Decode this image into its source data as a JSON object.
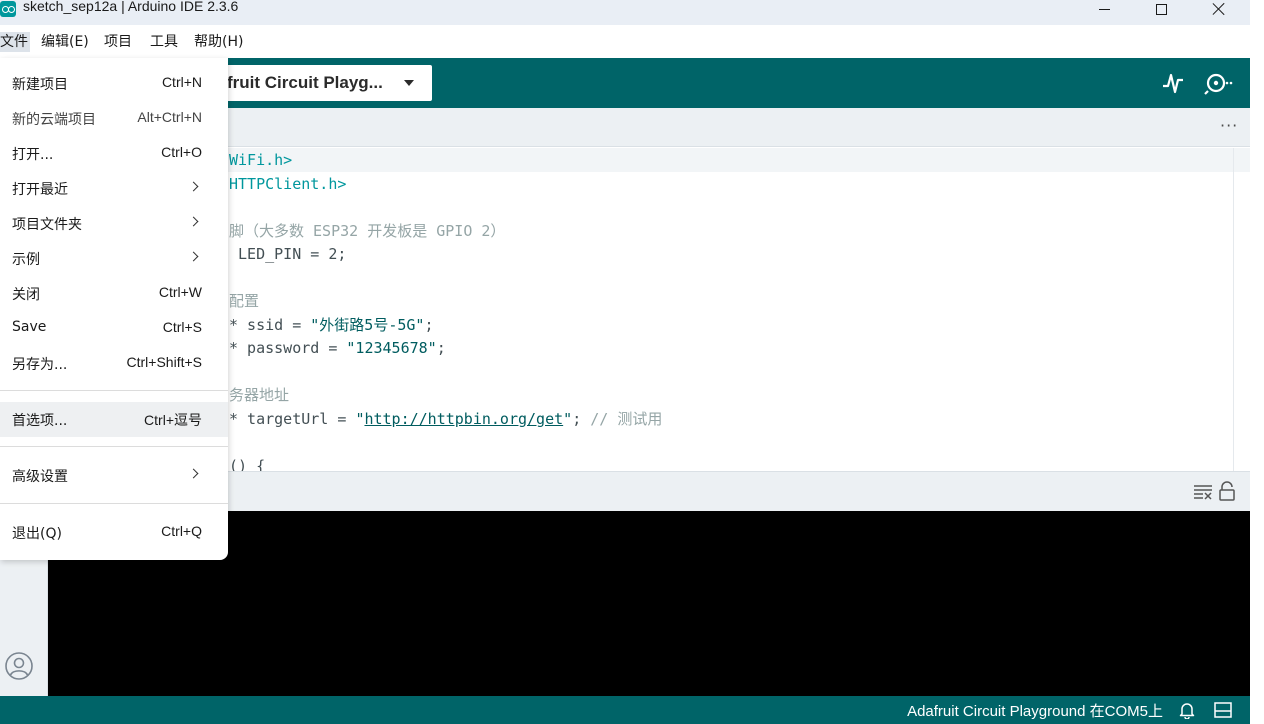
{
  "window": {
    "title": "sketch_sep12a | Arduino IDE 2.3.6",
    "icon": "arduino-logo-icon",
    "controls": [
      "minimize-icon",
      "maximize-icon",
      "close-icon"
    ]
  },
  "menubar": {
    "items": [
      "文件",
      "编辑(E)",
      "项目",
      "工具",
      "帮助(H)"
    ]
  },
  "toolbar": {
    "board_label": "fruit Circuit Playg...",
    "icons": [
      "serial-plotter-icon",
      "serial-monitor-icon"
    ]
  },
  "tabstrip": {
    "more_label": "···"
  },
  "editor": {
    "lines": [
      {
        "segs": [
          [
            "c-green",
            "WiFi.h>"
          ]
        ]
      },
      {
        "segs": [
          [
            "c-green",
            "HTTPClient.h>"
          ]
        ]
      },
      {
        "segs": []
      },
      {
        "segs": [
          [
            "c-gray",
            "脚（大多数 ESP32 开发板是 GPIO 2）"
          ]
        ]
      },
      {
        "segs": [
          [
            "",
            " LED_PIN = 2;"
          ]
        ]
      },
      {
        "segs": []
      },
      {
        "segs": [
          [
            "c-gray",
            "配置"
          ]
        ]
      },
      {
        "segs": [
          [
            "",
            "* ssid = "
          ],
          [
            "c-blue",
            "\"外街路5号-5G\""
          ],
          [
            "",
            ";"
          ]
        ]
      },
      {
        "segs": [
          [
            "",
            "* password = "
          ],
          [
            "c-blue",
            "\"12345678\""
          ],
          [
            "",
            ";"
          ]
        ]
      },
      {
        "segs": []
      },
      {
        "segs": [
          [
            "c-gray",
            "务器地址"
          ]
        ]
      },
      {
        "segs": [
          [
            "",
            "* targetUrl = "
          ],
          [
            "c-blue",
            "\""
          ],
          [
            "c-link",
            "http://httpbin.org/get"
          ],
          [
            "c-blue",
            "\""
          ],
          [
            "",
            "; "
          ],
          [
            "c-gray",
            "// 测试用"
          ]
        ]
      },
      {
        "segs": []
      },
      {
        "segs": [
          [
            "",
            "() {"
          ]
        ]
      }
    ]
  },
  "file_menu": {
    "items": [
      {
        "label": "新建项目",
        "shortcut": "Ctrl+N",
        "submenu": false,
        "dim": false
      },
      {
        "label": "新的云端项目",
        "shortcut": "Alt+Ctrl+N",
        "submenu": false,
        "dim": true
      },
      {
        "label": "打开...",
        "shortcut": "Ctrl+O",
        "submenu": false,
        "dim": false
      },
      {
        "label": "打开最近",
        "shortcut": "",
        "submenu": true,
        "dim": false
      },
      {
        "label": "项目文件夹",
        "shortcut": "",
        "submenu": true,
        "dim": false
      },
      {
        "label": "示例",
        "shortcut": "",
        "submenu": true,
        "dim": false
      },
      {
        "label": "关闭",
        "shortcut": "Ctrl+W",
        "submenu": false,
        "dim": false
      },
      {
        "label": "Save",
        "shortcut": "Ctrl+S",
        "submenu": false,
        "dim": false
      },
      {
        "label": "另存为...",
        "shortcut": "Ctrl+Shift+S",
        "submenu": false,
        "dim": false
      },
      {
        "label": "首选项...",
        "shortcut": "Ctrl+逗号",
        "submenu": false,
        "dim": false
      },
      {
        "label": "高级设置",
        "shortcut": "",
        "submenu": true,
        "dim": false
      },
      {
        "label": "退出(Q)",
        "shortcut": "Ctrl+Q",
        "submenu": false,
        "dim": false
      }
    ],
    "highlighted_index": 9
  },
  "statusbar": {
    "board_port": "Adafruit Circuit Playground 在COM5上",
    "icons": [
      "notification-bell-icon",
      "toggle-panel-icon"
    ]
  },
  "colors": {
    "teal_toolbar": "#006468",
    "panel_bg": "#ecf0f3",
    "console_bg": "#000000"
  }
}
